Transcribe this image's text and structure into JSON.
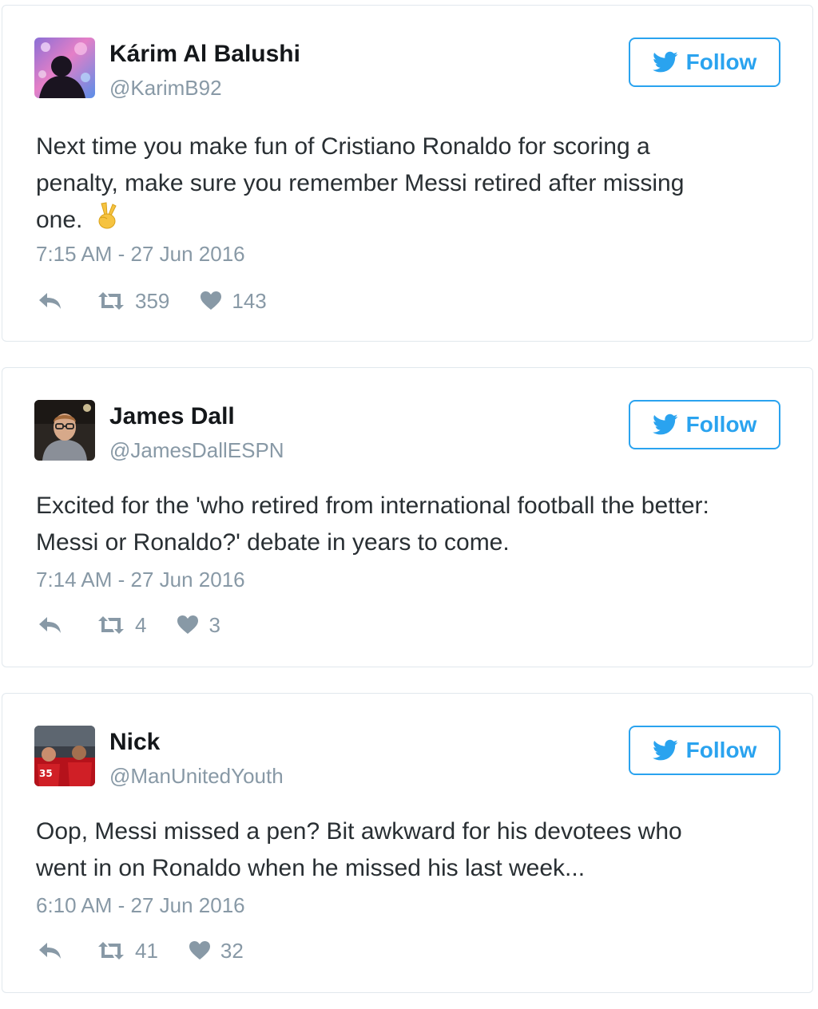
{
  "tweets": [
    {
      "name": "Kárim Al Balushi",
      "handle": "@KarimB92",
      "follow_label": "Follow",
      "text_lines": [
        "Next time you make fun of Cristiano Ronaldo for scoring a",
        "penalty, make sure you remember Messi retired after missing",
        "one."
      ],
      "emoji": "victory-hand",
      "timestamp": "7:15 AM - 27 Jun 2016",
      "retweets": "359",
      "likes": "143"
    },
    {
      "name": "James Dall",
      "handle": "@JamesDallESPN",
      "follow_label": "Follow",
      "text_lines": [
        "Excited for the 'who retired from international football the better:",
        "Messi or Ronaldo?' debate in years to come."
      ],
      "timestamp": "7:14 AM - 27 Jun 2016",
      "retweets": "4",
      "likes": "3"
    },
    {
      "name": "Nick",
      "handle": "@ManUnitedYouth",
      "follow_label": "Follow",
      "text_lines": [
        "Oop, Messi missed a pen? Bit awkward for his devotees who",
        "went in on Ronaldo when he missed his last week..."
      ],
      "timestamp": "6:10 AM - 27 Jun 2016",
      "retweets": "41",
      "likes": "32"
    }
  ],
  "colors": {
    "follow_blue": "#2aa3ef",
    "muted_gray": "#8899a6",
    "text": "#292f33",
    "border": "#e1e8ed"
  }
}
